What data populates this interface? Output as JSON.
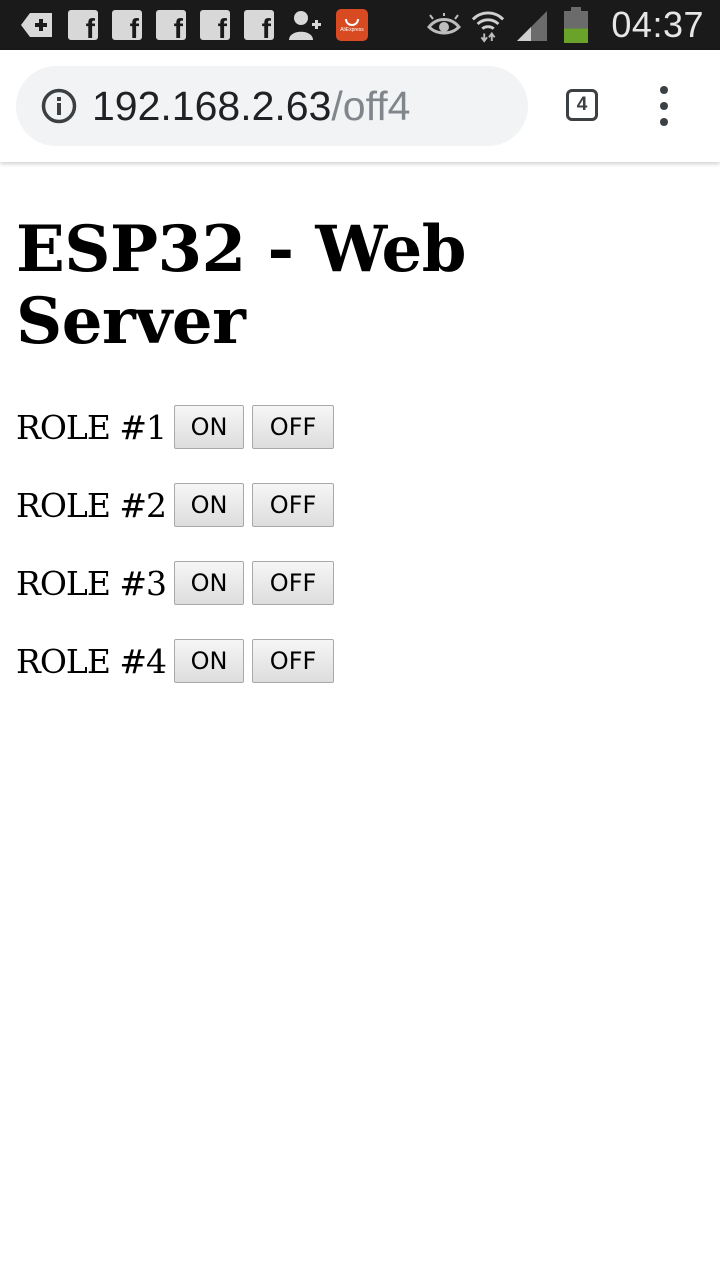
{
  "status_bar": {
    "time": "04:37",
    "icons": [
      "add-notification-icon",
      "facebook-icon",
      "facebook-icon",
      "facebook-icon",
      "facebook-icon",
      "facebook-icon",
      "add-contact-icon",
      "aliexpress-icon",
      "eye-icon",
      "wifi-icon",
      "signal-icon",
      "battery-icon"
    ],
    "battery_level": 0.45,
    "aliexpress_text": "AliExpress"
  },
  "browser": {
    "url_host": "192.168.2.63",
    "url_path": "/off4",
    "tab_count": "4"
  },
  "page": {
    "title": "ESP32 - Web Server",
    "roles": [
      {
        "label": "ROLE #1",
        "on": "ON",
        "off": "OFF"
      },
      {
        "label": "ROLE #2",
        "on": "ON",
        "off": "OFF"
      },
      {
        "label": "ROLE #3",
        "on": "ON",
        "off": "OFF"
      },
      {
        "label": "ROLE #4",
        "on": "ON",
        "off": "OFF"
      }
    ]
  },
  "colors": {
    "status_bar_bg": "#1a1a1a",
    "url_bar_bg": "#f1f3f4",
    "battery_green": "#6aa329",
    "aliexpress_red": "#d84a22"
  }
}
